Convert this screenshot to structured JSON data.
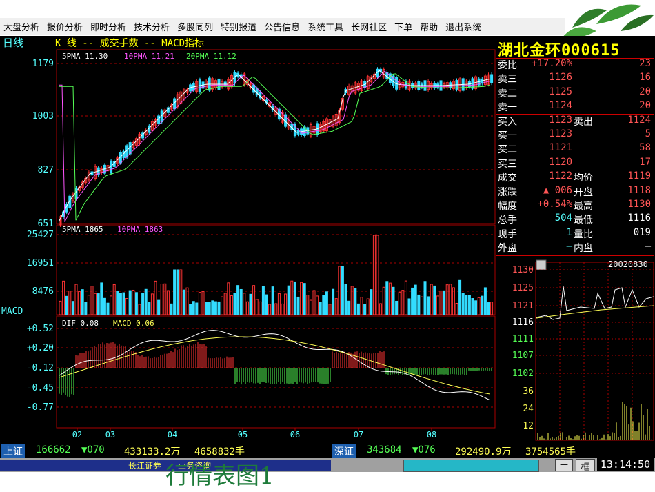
{
  "menu": [
    "大盘分析",
    "报价分析",
    "即时分析",
    "技术分析",
    "多股同列",
    "特别报道",
    "公告信息",
    "系统工具",
    "长网社区",
    "下单",
    "帮助",
    "退出系统"
  ],
  "chart": {
    "period": "日线",
    "title": "K  线 -- 成交手数 -- MACD指标",
    "ma_legend": {
      "ma5": "5PMA  11.30",
      "ma10": "10PMA  11.21",
      "ma20": "20PMA  11.12"
    },
    "price_ticks": [
      "1179",
      "1003",
      "827",
      "651"
    ],
    "vol_legend": {
      "v5": "5PMA  1865",
      "v10": "10PMA  1863"
    },
    "vol_ticks": [
      "25427",
      "16951",
      "8476"
    ],
    "macd_label": "MACD",
    "macd_legend": {
      "dif": "DIF  0.08",
      "macd": "MACD  0.06"
    },
    "macd_ticks": [
      "+0.52",
      "+0.20",
      "-0.12",
      "-0.45",
      "-0.77"
    ],
    "month_ticks": [
      "02",
      "03",
      "04",
      "05",
      "06",
      "07",
      "08"
    ]
  },
  "stock": {
    "name": "湖北金环000615"
  },
  "quote": {
    "rows": [
      {
        "l": "委比",
        "v": "+17.20%",
        "r": "23"
      },
      {
        "l": "卖三",
        "v": "1126",
        "r": "16"
      },
      {
        "l": "卖二",
        "v": "1125",
        "r": "20"
      },
      {
        "l": "卖一",
        "v": "1124",
        "r": "20"
      },
      {
        "l": "买入",
        "v": "1123",
        "m": "卖出",
        "r": "1124"
      },
      {
        "l": "买一",
        "v": "1123",
        "r": "5"
      },
      {
        "l": "买二",
        "v": "1121",
        "r": "58"
      },
      {
        "l": "买三",
        "v": "1120",
        "r": "17"
      },
      {
        "l": "成交",
        "v": "1122",
        "m": "均价",
        "r": "1119"
      },
      {
        "l": "涨跌",
        "v": "▲ 006",
        "m": "开盘",
        "r": "1118"
      },
      {
        "l": "幅度",
        "v": "+0.54%",
        "m": "最高",
        "r": "1130"
      },
      {
        "l": "总手",
        "v": "504",
        "m": "最低",
        "r": "1116"
      },
      {
        "l": "现手",
        "v": "1",
        "m": "量比",
        "r": "019"
      },
      {
        "l": "外盘",
        "v": "—",
        "m": "内盘",
        "r": "—"
      }
    ]
  },
  "mini": {
    "date": "20020830",
    "price_ticks": [
      "1130",
      "1125",
      "1121",
      "1116",
      "1111",
      "1107",
      "1102"
    ],
    "vol_ticks": [
      "36",
      "24",
      "12"
    ]
  },
  "bottom": {
    "sh_label": "上证",
    "sh_index": "166662",
    "sh_change": "▼070",
    "sh_amount": "433133.2万",
    "sh_volume": "4658832手",
    "sz_label": "深证",
    "sz_index": "343684",
    "sz_change": "▼076",
    "sz_amount": "292490.9万",
    "sz_volume": "3754565手"
  },
  "status": {
    "broker": "长江证券",
    "service": "业务咨询",
    "button1": "—",
    "button2": "框",
    "time": "13:14:50"
  },
  "caption": "行情表图1",
  "colors": {
    "up": "#ff3333",
    "down": "#33ddff",
    "ma5": "#ffffff",
    "ma10": "#ff55ff",
    "ma20": "#55ff55",
    "grid": "#aa0000",
    "label_cyan": "#55ffff",
    "yellow": "#ffff00"
  }
}
